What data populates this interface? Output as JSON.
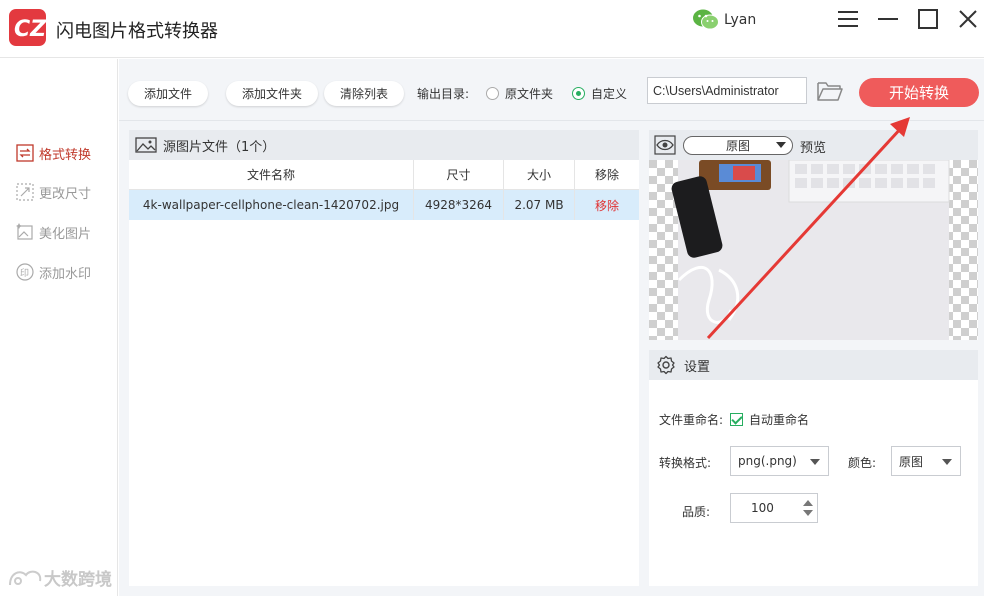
{
  "app": {
    "title": "闪电图片格式转换器",
    "user_name": "Lyan"
  },
  "sidebar": {
    "items": [
      {
        "label": "格式转换",
        "icon": "convert-icon",
        "active": true
      },
      {
        "label": "更改尺寸",
        "icon": "resize-icon",
        "active": false
      },
      {
        "label": "美化图片",
        "icon": "beautify-icon",
        "active": false
      },
      {
        "label": "添加水印",
        "icon": "watermark-stamp-icon",
        "active": false
      }
    ],
    "watermark_text": "大数跨境"
  },
  "toolbar": {
    "add_file": "添加文件",
    "add_folder": "添加文件夹",
    "clear_list": "清除列表",
    "output_label": "输出目录:",
    "radio_original": "原文件夹",
    "radio_custom": "自定义",
    "output_path": "C:\\Users\\Administrator",
    "start": "开始转换"
  },
  "file_panel": {
    "title": "源图片文件（1个）",
    "columns": [
      "文件名称",
      "尺寸",
      "大小",
      "移除"
    ],
    "rows": [
      {
        "name": "4k-wallpaper-cellphone-clean-1420702.jpg",
        "size": "4928*3264",
        "filesize": "2.07 MB",
        "remove": "移除"
      }
    ]
  },
  "preview": {
    "select_value": "原图",
    "label": "预览"
  },
  "settings": {
    "title": "设置",
    "rename_label": "文件重命名:",
    "auto_rename": "自动重命名",
    "format_label": "转换格式:",
    "format_value": "png(.png)",
    "color_label": "颜色:",
    "color_value": "原图",
    "quality_label": "品质:",
    "quality_value": "100"
  },
  "colors": {
    "accent": "#e3393f",
    "start_button": "#ef5b5b",
    "selected_row": "#d8ecfb",
    "check_green": "#27ae60"
  }
}
